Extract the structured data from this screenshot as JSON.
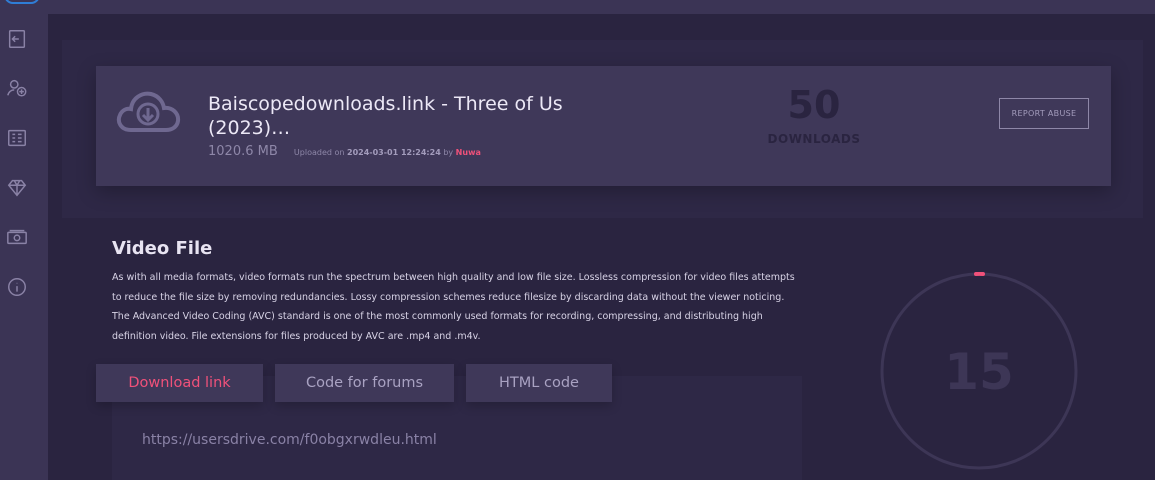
{
  "sidebar": {
    "icons": [
      "sign-in-icon",
      "add-user-icon",
      "list-icon",
      "diamond-icon",
      "money-icon",
      "info-icon"
    ]
  },
  "file": {
    "title": "Baiscopedownloads.link - Three of Us (2023)…",
    "size": "1020.6 MB",
    "uploaded_prefix": "Uploaded on",
    "uploaded_date": "2024-03-01 12:24:24",
    "uploaded_by": "by",
    "uploader": "Nuwa",
    "downloads_count": "50",
    "downloads_label": "DOWNLOADS",
    "report_label": "REPORT ABUSE"
  },
  "content": {
    "section_title": "Video File",
    "description": "As with all media formats, video formats run the spectrum between high quality and low file size. Lossless compression for video files attempts to reduce the file size by removing redundancies. Lossy compression schemes reduce filesize by discarding data without the viewer noticing. The Advanced Video Coding (AVC) standard is one of the most commonly used formats for recording, compressing, and distributing high definition video. File extensions for files produced by AVC are .mp4 and .m4v."
  },
  "tabs": {
    "download_link": "Download link",
    "code_forums": "Code for forums",
    "html_code": "HTML code"
  },
  "link": {
    "url": "https://usersdrive.com/f0obgxrwdleu.html"
  },
  "timer": {
    "value": "15",
    "progress": 0.0
  },
  "colors": {
    "accent": "#f0517a",
    "background": "#2a2440",
    "card": "#3f3859"
  }
}
